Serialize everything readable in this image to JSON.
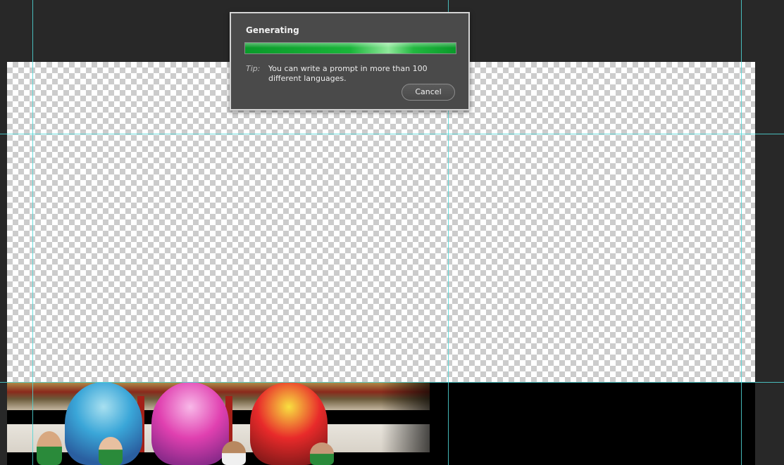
{
  "dialog": {
    "title": "Generating",
    "progress": 1.0,
    "tip_label": "Tip:",
    "tip_text": "You can write a prompt in more than 100 different languages.",
    "cancel_label": "Cancel"
  },
  "colors": {
    "workspace_bg": "#282828",
    "guide": "#4fd6d6",
    "progress_green": "#1ab53a",
    "dialog_bg": "#4a4a4a"
  }
}
